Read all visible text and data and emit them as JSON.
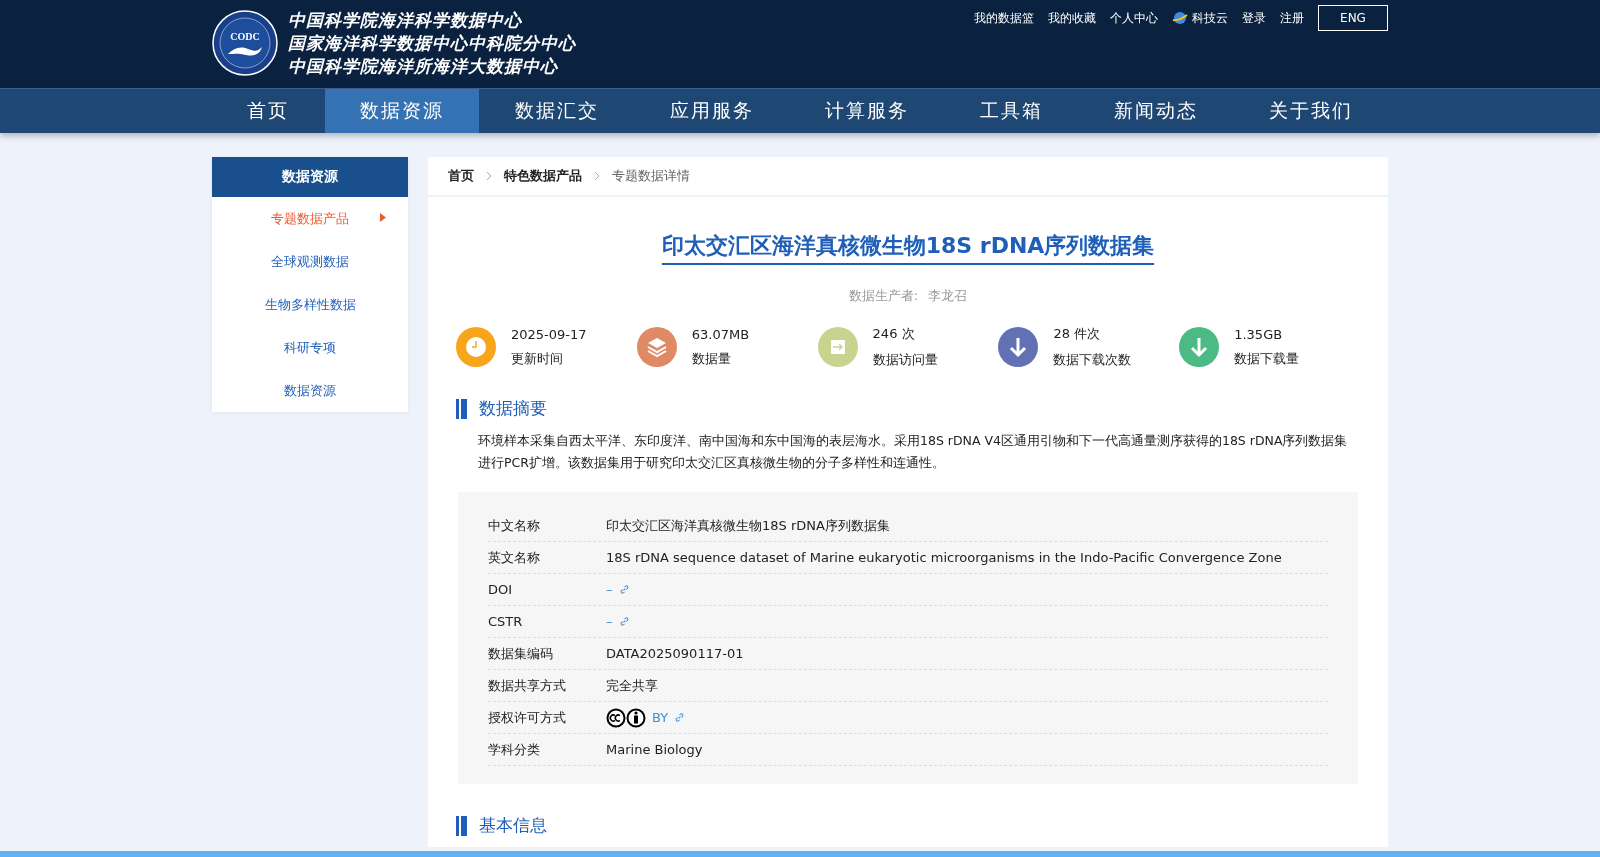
{
  "header": {
    "logo_text": "CODC",
    "org_names": [
      "中国科学院海洋科学数据中心",
      "国家海洋科学数据中心中科院分中心",
      "中国科学院海洋所海洋大数据中心"
    ],
    "top_links": [
      {
        "label": "我的数据篮",
        "kind": "text"
      },
      {
        "label": "我的收藏",
        "kind": "text"
      },
      {
        "label": "个人中心",
        "kind": "text"
      },
      {
        "label": "科技云",
        "kind": "globe"
      },
      {
        "label": "登录",
        "kind": "text"
      },
      {
        "label": "注册",
        "kind": "text"
      }
    ],
    "language_button": "ENG"
  },
  "nav": [
    {
      "label": "首页",
      "selected": false
    },
    {
      "label": "数据资源",
      "selected": true
    },
    {
      "label": "数据汇交",
      "selected": false
    },
    {
      "label": "应用服务",
      "selected": false
    },
    {
      "label": "计算服务",
      "selected": false
    },
    {
      "label": "工具箱",
      "selected": false
    },
    {
      "label": "新闻动态",
      "selected": false
    },
    {
      "label": "关于我们",
      "selected": false
    }
  ],
  "sidebar": {
    "title": "数据资源",
    "items": [
      {
        "label": "专题数据产品",
        "selected": true
      },
      {
        "label": "全球观测数据",
        "selected": false
      },
      {
        "label": "生物多样性数据",
        "selected": false
      },
      {
        "label": "科研专项",
        "selected": false
      },
      {
        "label": "数据资源",
        "selected": false
      }
    ]
  },
  "breadcrumb": [
    {
      "label": "首页",
      "current": false
    },
    {
      "label": "特色数据产品",
      "current": false
    },
    {
      "label": "专题数据详情",
      "current": true
    }
  ],
  "dataset": {
    "title": "印太交汇区海洋真核微生物18S rDNA序列数据集",
    "producer_label": "数据生产者:",
    "producer": "李龙召",
    "stats": [
      {
        "kind": "clock",
        "color": "#f8a51b",
        "value": "2025-09-17",
        "label": "更新时间"
      },
      {
        "kind": "layers",
        "color": "#e08a65",
        "value": "63.07MB",
        "label": "数据量"
      },
      {
        "kind": "enter",
        "color": "#c9d38f",
        "value": "246 次",
        "label": "数据访问量"
      },
      {
        "kind": "download",
        "color": "#6271b3",
        "value": "28 件次",
        "label": "数据下载次数"
      },
      {
        "kind": "download",
        "color": "#4cba85",
        "value": "1.35GB",
        "label": "数据下载量"
      }
    ],
    "abstract_heading": "数据摘要",
    "abstract": "环境样本采集自西太平洋、东印度洋、南中国海和东中国海的表层海水。采用18S rDNA V4区通用引物和下一代高通量测序获得的18S rDNA序列数据集进行PCR扩增。该数据集用于研究印太交汇区真核微生物的分子多样性和连通性。",
    "fields": [
      {
        "kind": "text",
        "label": "中文名称",
        "value": "印太交汇区海洋真核微生物18S rDNA序列数据集"
      },
      {
        "kind": "text",
        "label": "英文名称",
        "value": "18S rDNA sequence dataset of Marine eukaryotic microorganisms in the Indo-Pacific Convergence Zone"
      },
      {
        "kind": "link",
        "label": "DOI",
        "value": "–"
      },
      {
        "kind": "link",
        "label": "CSTR",
        "value": "–"
      },
      {
        "kind": "text",
        "label": "数据集编码",
        "value": "DATA2025090117-01"
      },
      {
        "kind": "text",
        "label": "数据共享方式",
        "value": "完全共享"
      },
      {
        "kind": "license",
        "label": "授权许可方式",
        "value": "BY"
      },
      {
        "kind": "text",
        "label": "学科分类",
        "value": "Marine Biology"
      }
    ],
    "next_heading": "基本信息"
  }
}
